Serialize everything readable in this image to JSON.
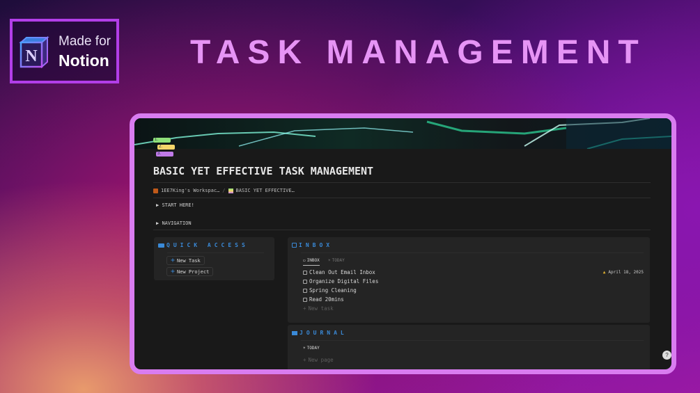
{
  "badge": {
    "line1": "Made for",
    "line2": "Notion",
    "logo_letter": "N"
  },
  "headline": "TASK MANAGEMENT",
  "page": {
    "icon_items": [
      "1.",
      "2.",
      "3."
    ],
    "title": "BASIC YET EFFECTIVE TASK MANAGEMENT",
    "breadcrumb": [
      {
        "label": "1EE7King's Workspac…"
      },
      {
        "label": "BASIC YET EFFECTIVE…"
      }
    ],
    "breadcrumb_sep": "/",
    "toggles": [
      "START HERE!",
      "NAVIGATION"
    ],
    "quick_access": {
      "title": "QUICK ACCESS",
      "buttons": [
        "New Task",
        "New Project"
      ]
    },
    "inbox": {
      "title": "INBOX",
      "tabs": [
        "INBOX",
        "TODAY"
      ],
      "tasks": [
        "Clean Out Email Inbox",
        "Organize Digital Files",
        "Spring Cleaning",
        "Read 20mins"
      ],
      "due_date": "April 18, 2025",
      "new_task": "New task"
    },
    "journal": {
      "title": "JOURNAL",
      "view": "TODAY",
      "new_page": "New page"
    },
    "help": "?"
  },
  "colors": {
    "accent": "#3a8ad8",
    "frame": "#d97cf0",
    "headline": "#e694f5",
    "bg": "#191919",
    "card": "#242424"
  }
}
